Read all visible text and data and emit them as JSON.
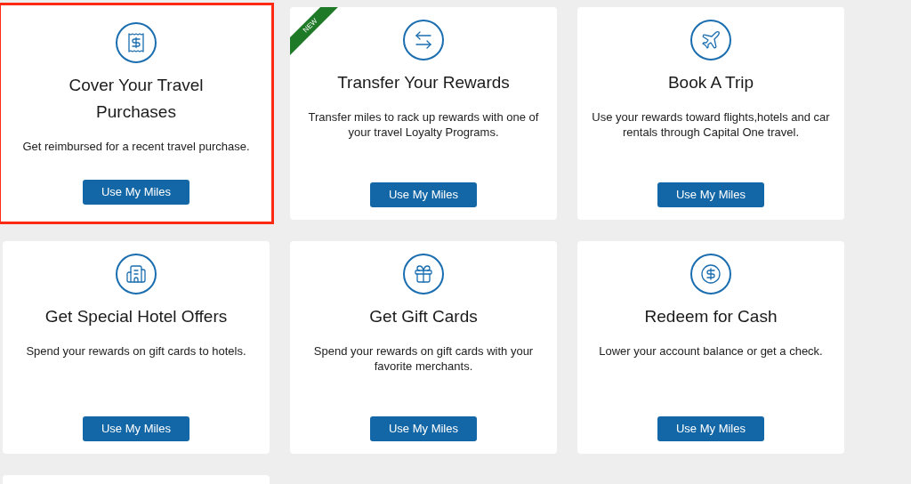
{
  "cards": [
    {
      "title": "Cover Your Travel Purchases",
      "description": "Get reimbursed for a recent travel purchase.",
      "button": "Use My Miles",
      "highlighted": true
    },
    {
      "title": "Transfer Your Rewards",
      "description": "Transfer miles to rack up rewards with one of your travel Loyalty Programs.",
      "button": "Use My Miles",
      "badge": "NEW",
      "highlighted": false
    },
    {
      "title": "Book A Trip",
      "description": "Use your rewards toward flights,hotels and car rentals through Capital One travel.",
      "button": "Use My Miles",
      "highlighted": false
    },
    {
      "title": "Get Special Hotel Offers",
      "description": "Spend your rewards on gift cards to hotels.",
      "button": "Use My Miles",
      "highlighted": false
    },
    {
      "title": "Get Gift Cards",
      "description": "Spend your rewards on gift cards with your favorite merchants.",
      "button": "Use My Miles",
      "highlighted": false
    },
    {
      "title": "Redeem for Cash",
      "description": "Lower your account balance or get a check.",
      "button": "Use My Miles",
      "highlighted": false
    }
  ]
}
